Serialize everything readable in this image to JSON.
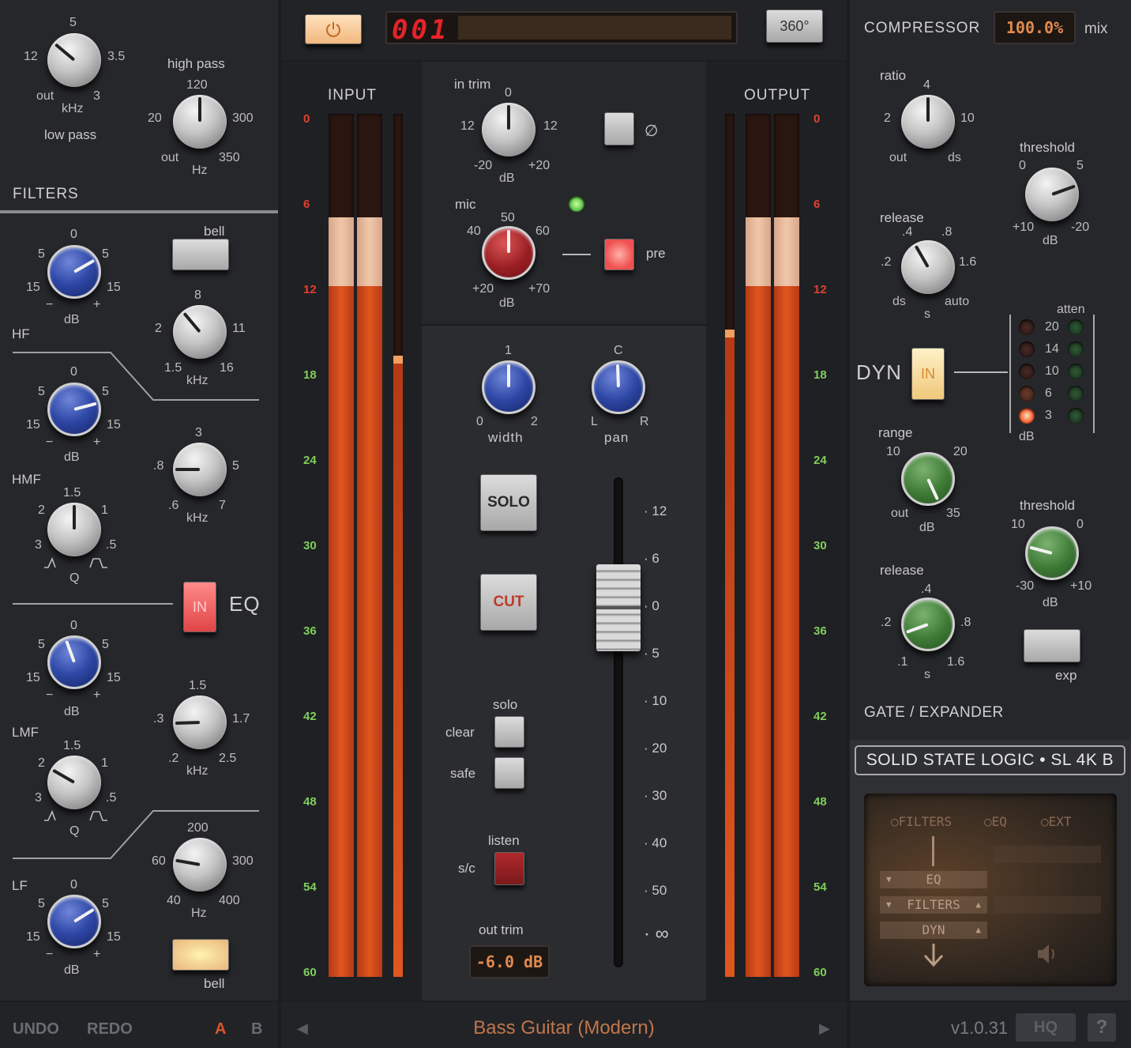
{
  "colors": {
    "meter_red": "#e35b28",
    "scale_red": "#e2402c",
    "scale_green": "#7fcf5a",
    "led_green": "#6dd65e",
    "display_orange": "#e08a4e",
    "eq_in_red": "#e74e4e",
    "dyn_in_amber": "#f0c87a"
  },
  "top": {
    "display_value": "001",
    "view_button": "360°",
    "power_icon": "power-icon"
  },
  "filters": {
    "title": "FILTERS",
    "low_pass": {
      "label": "low pass",
      "unit": "kHz",
      "ticks": [
        "5",
        "12",
        "3.5",
        "out",
        "3"
      ]
    },
    "high_pass": {
      "label": "high pass",
      "unit": "Hz",
      "ticks": [
        "120",
        "20",
        "300",
        "out",
        "350"
      ]
    }
  },
  "eq": {
    "title": "EQ",
    "in_label": "IN",
    "hf": {
      "name": "HF",
      "bell_label": "bell",
      "gain_unit": "dB",
      "gain_ticks": [
        "0",
        "5",
        "5",
        "15",
        "15",
        "−",
        "+"
      ],
      "freq_unit": "kHz",
      "freq_ticks": [
        "8",
        "2",
        "11",
        "1.5",
        "16"
      ]
    },
    "hmf": {
      "name": "HMF",
      "gain_unit": "dB",
      "gain_ticks": [
        "0",
        "5",
        "5",
        "15",
        "15",
        "−",
        "+"
      ],
      "freq_unit": "kHz",
      "freq_ticks": [
        "3",
        ".8",
        "5",
        ".6",
        "7"
      ],
      "q_unit": "Q",
      "q_ticks": [
        "1.5",
        "2",
        "1",
        "3",
        ".5"
      ]
    },
    "lmf": {
      "name": "LMF",
      "gain_unit": "dB",
      "gain_ticks": [
        "0",
        "5",
        "5",
        "15",
        "15",
        "−",
        "+"
      ],
      "freq_unit": "kHz",
      "freq_ticks": [
        "1.5",
        ".3",
        "1.7",
        ".2",
        "2.5"
      ],
      "q_unit": "Q",
      "q_ticks": [
        "1.5",
        "2",
        "1",
        "3",
        ".5"
      ]
    },
    "lf": {
      "name": "LF",
      "bell_label": "bell",
      "gain_unit": "dB",
      "gain_ticks": [
        "0",
        "5",
        "5",
        "15",
        "15",
        "−",
        "+"
      ],
      "freq_unit": "Hz",
      "freq_ticks": [
        "200",
        "60",
        "300",
        "40",
        "400"
      ]
    }
  },
  "meters": {
    "input_title": "INPUT",
    "output_title": "OUTPUT",
    "scale": [
      "0",
      "6",
      "12",
      "18",
      "24",
      "30",
      "36",
      "42",
      "48",
      "54",
      "60"
    ],
    "input_levels": [
      0.88,
      0.88
    ],
    "input_peak": 0.72,
    "output_levels": [
      0.88,
      0.88
    ],
    "output_peak": 0.75
  },
  "channel": {
    "in_trim": {
      "label": "in trim",
      "unit": "dB",
      "ticks": [
        "0",
        "12",
        "12",
        "-20",
        "+20"
      ]
    },
    "phase_symbol": "∅",
    "mic": {
      "label": "mic",
      "unit": "dB",
      "ticks": [
        "50",
        "40",
        "60",
        "+20",
        "+70"
      ]
    },
    "pre_label": "pre",
    "width": {
      "label": "width",
      "ticks": [
        "1",
        "0",
        "2"
      ]
    },
    "pan": {
      "label": "pan",
      "ticks": [
        "C",
        "L",
        "R"
      ]
    },
    "solo_label": "SOLO",
    "cut_label": "CUT",
    "solo_group": "solo",
    "clear_label": "clear",
    "safe_label": "safe",
    "listen_label": "listen",
    "sc_label": "s/c",
    "out_trim_label": "out trim",
    "out_trim_value": "-6.0 dB",
    "fader_scale": [
      "12",
      "6",
      "0",
      "5",
      "10",
      "20",
      "30",
      "40",
      "50",
      "∞"
    ]
  },
  "compressor": {
    "title": "COMPRESSOR",
    "mix_value": "100.0%",
    "mix_label": "mix",
    "ratio": {
      "label": "ratio",
      "ticks": [
        "4",
        "2",
        "10",
        "out",
        "ds"
      ]
    },
    "threshold": {
      "label": "threshold",
      "unit": "dB",
      "ticks": [
        "0",
        "5",
        "+10",
        "-20"
      ]
    },
    "release": {
      "label": "release",
      "unit": "s",
      "ticks": [
        ".4",
        ".8",
        ".2",
        "1.6",
        "ds",
        "auto"
      ]
    }
  },
  "dyn": {
    "label": "DYN",
    "in_label": "IN",
    "atten_label": "atten",
    "atten_unit": "dB",
    "atten_values": [
      "20",
      "14",
      "10",
      "6",
      "3"
    ]
  },
  "gate": {
    "title": "GATE / EXPANDER",
    "range": {
      "label": "range",
      "unit": "dB",
      "ticks": [
        "10",
        "20",
        "out",
        "35"
      ]
    },
    "threshold": {
      "label": "threshold",
      "unit": "dB",
      "ticks": [
        "10",
        "0",
        "-30",
        "+10"
      ]
    },
    "release": {
      "label": "release",
      "unit": "s",
      "ticks": [
        ".4",
        ".2",
        ".8",
        ".1",
        "1.6"
      ]
    },
    "exp_label": "exp"
  },
  "brand": "SOLID STATE LOGIC • SL 4K B",
  "routing": {
    "options": [
      "FILTERS",
      "EQ",
      "EXT"
    ],
    "chain": [
      "EQ",
      "FILTERS",
      "DYN"
    ]
  },
  "footer": {
    "undo": "UNDO",
    "redo": "REDO",
    "a": "A",
    "b": "B",
    "preset": "Bass Guitar (Modern)",
    "version": "v1.0.31",
    "hq": "HQ",
    "help": "?"
  }
}
